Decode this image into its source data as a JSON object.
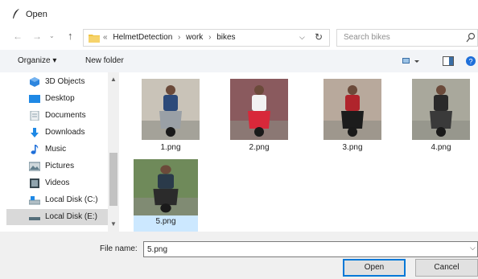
{
  "window": {
    "title": "Open"
  },
  "address": {
    "crumbs": [
      "«",
      "HelmetDetection",
      "›",
      "work",
      "›",
      "bikes"
    ]
  },
  "search": {
    "placeholder": "Search bikes"
  },
  "toolbar": {
    "organize": "Organize ▾",
    "new_folder": "New folder"
  },
  "sidebar": {
    "items": [
      {
        "label": "3D Objects",
        "icon": "3d-objects-icon",
        "color": "#2e86de"
      },
      {
        "label": "Desktop",
        "icon": "desktop-icon",
        "color": "#1e88e5"
      },
      {
        "label": "Documents",
        "icon": "documents-icon",
        "color": "#90a4ae"
      },
      {
        "label": "Downloads",
        "icon": "downloads-icon",
        "color": "#1e88e5"
      },
      {
        "label": "Music",
        "icon": "music-icon",
        "color": "#1e6fd9"
      },
      {
        "label": "Pictures",
        "icon": "pictures-icon",
        "color": "#607d8b"
      },
      {
        "label": "Videos",
        "icon": "videos-icon",
        "color": "#37474f"
      },
      {
        "label": "Local Disk (C:)",
        "icon": "drive-c-icon",
        "color": "#78909c"
      },
      {
        "label": "Local Disk (E:)",
        "icon": "drive-e-icon",
        "color": "#546e7a"
      }
    ]
  },
  "files": [
    {
      "name": "1.png",
      "bg": "#c9c3b8",
      "shirt": "#2c4a7a",
      "bike": "#9aa0a6"
    },
    {
      "name": "2.png",
      "bg": "#8a5a5e",
      "shirt": "#f2f2f2",
      "bike": "#d8283a"
    },
    {
      "name": "3.png",
      "bg": "#b8a99c",
      "shirt": "#b0242c",
      "bike": "#1c1c1c"
    },
    {
      "name": "4.png",
      "bg": "#a9a89c",
      "shirt": "#2a2a2a",
      "bike": "#3a3a3a"
    },
    {
      "name": "5.png",
      "bg": "#6f8a5a",
      "shirt": "#2a3a4a",
      "bike": "#2b2b2b"
    }
  ],
  "filename": {
    "label": "File name:",
    "value": "5.png"
  },
  "buttons": {
    "open": "Open",
    "cancel": "Cancel"
  }
}
